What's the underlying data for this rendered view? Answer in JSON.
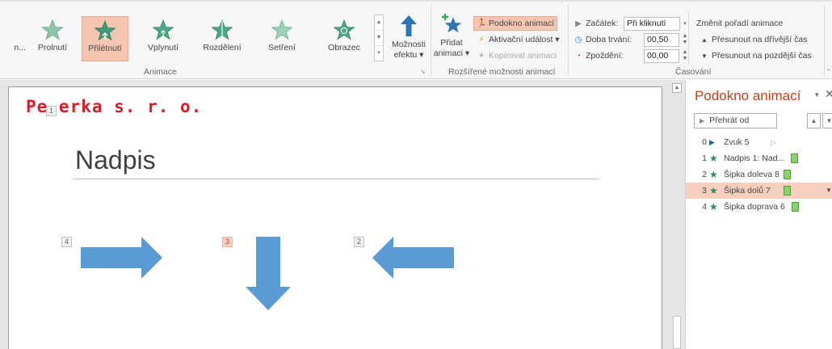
{
  "ribbon": {
    "effects": [
      {
        "label": "n...",
        "selected": false
      },
      {
        "label": "Prolnutí",
        "selected": false
      },
      {
        "label": "Přilétnutí",
        "selected": true
      },
      {
        "label": "Vplynutí",
        "selected": false
      },
      {
        "label": "Rozdělení",
        "selected": false
      },
      {
        "label": "Setření",
        "selected": false
      },
      {
        "label": "Obrazec",
        "selected": false
      }
    ],
    "effect_options_line1": "Možnosti",
    "effect_options_line2": "efektu",
    "group_animation": "Animace",
    "add_animation_line1": "Přidat",
    "add_animation_line2": "animaci",
    "animation_pane_btn": "Podokno animací",
    "trigger_btn": "Aktivační událost",
    "animation_painter_btn": "Kopírovat animaci",
    "group_advanced": "Rozšířené možnosti animací",
    "start_label": "Začátek:",
    "start_value": "Při kliknutí",
    "duration_label": "Doba trvání:",
    "duration_value": "00,50",
    "delay_label": "Zpoždění:",
    "delay_value": "00,00",
    "group_timing": "Časování",
    "reorder_title": "Změnit pořadí animace",
    "move_earlier": "Přesunout na dřívější čas",
    "move_later": "Přesunout na pozdější čas",
    "accent_color": "#f4c6b2"
  },
  "slide": {
    "logo": "Pe erka s. r. o.",
    "title": "Nadpis",
    "logo_tag": "1",
    "tags": {
      "left_arrow": "4",
      "down_arrow": "3",
      "right_arrow": "2"
    },
    "arrow_color": "#5b9bd5"
  },
  "pane": {
    "title": "Podokno animací",
    "play_label": "Přehrát od",
    "items": [
      {
        "num": "0",
        "icon": "sound-icon",
        "name": "Zvuk 5"
      },
      {
        "num": "1",
        "icon": "star-icon",
        "name": "Nadpis 1: Nad..."
      },
      {
        "num": "2",
        "icon": "star-icon",
        "name": "Šipka doleva 8"
      },
      {
        "num": "3",
        "icon": "star-icon",
        "name": "Šipka dolů 7",
        "selected": true
      },
      {
        "num": "4",
        "icon": "star-icon",
        "name": "Šipka doprava 6"
      }
    ],
    "title_color": "#c43e1c",
    "selected_color": "#f8cfbf"
  }
}
